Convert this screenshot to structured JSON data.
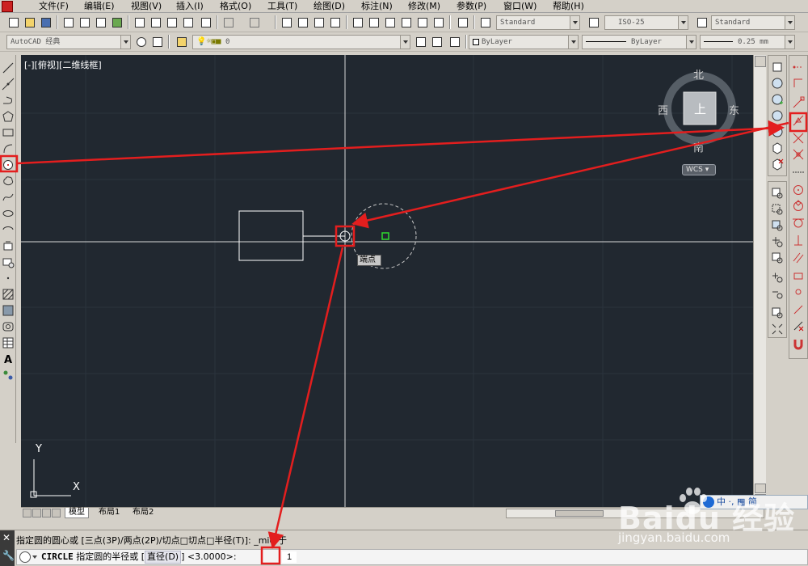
{
  "menubar": {
    "items": [
      "文件(F)",
      "编辑(E)",
      "视图(V)",
      "插入(I)",
      "格式(O)",
      "工具(T)",
      "绘图(D)",
      "标注(N)",
      "修改(M)",
      "参数(P)",
      "窗口(W)",
      "帮助(H)"
    ]
  },
  "toolbar1": {
    "text_style": "Standard",
    "dim_style": "ISO-25",
    "table_style": "Standard"
  },
  "toolbar2": {
    "workspace": "AutoCAD 经典",
    "layer": "0",
    "color": "ByLayer",
    "linetype": "ByLayer",
    "lineweight": "0.25 mm"
  },
  "canvas": {
    "view_label": "[-][俯视][二维线框]",
    "viewcube": {
      "north": "北",
      "south": "南",
      "east": "东",
      "west": "西",
      "face": "上",
      "wcs": "WCS"
    },
    "tooltip": "端点",
    "ucs_y": "Y",
    "ucs_x": "X"
  },
  "tabs": {
    "model": "模型",
    "layout1": "布局1",
    "layout2": "布局2"
  },
  "command": {
    "history": "指定圆的圆心或 [三点(3P)/两点(2P)/切点□切点□半径(T)]: _mid 于",
    "prompt_cmd": "CIRCLE",
    "prompt_text": "指定圆的半径或",
    "option": "直径(D)",
    "default": "<3.0000>:",
    "input_value": "1"
  },
  "ime": {
    "text": "中 ·,  ▦ 简"
  },
  "watermark": {
    "brand": "Baidu 经验",
    "url": "jingyan.baidu.com"
  },
  "colors": {
    "canvas_bg": "#212830",
    "highlight": "#e31e1e",
    "grid_line": "#2c3540",
    "geometry": "#ffffff"
  }
}
